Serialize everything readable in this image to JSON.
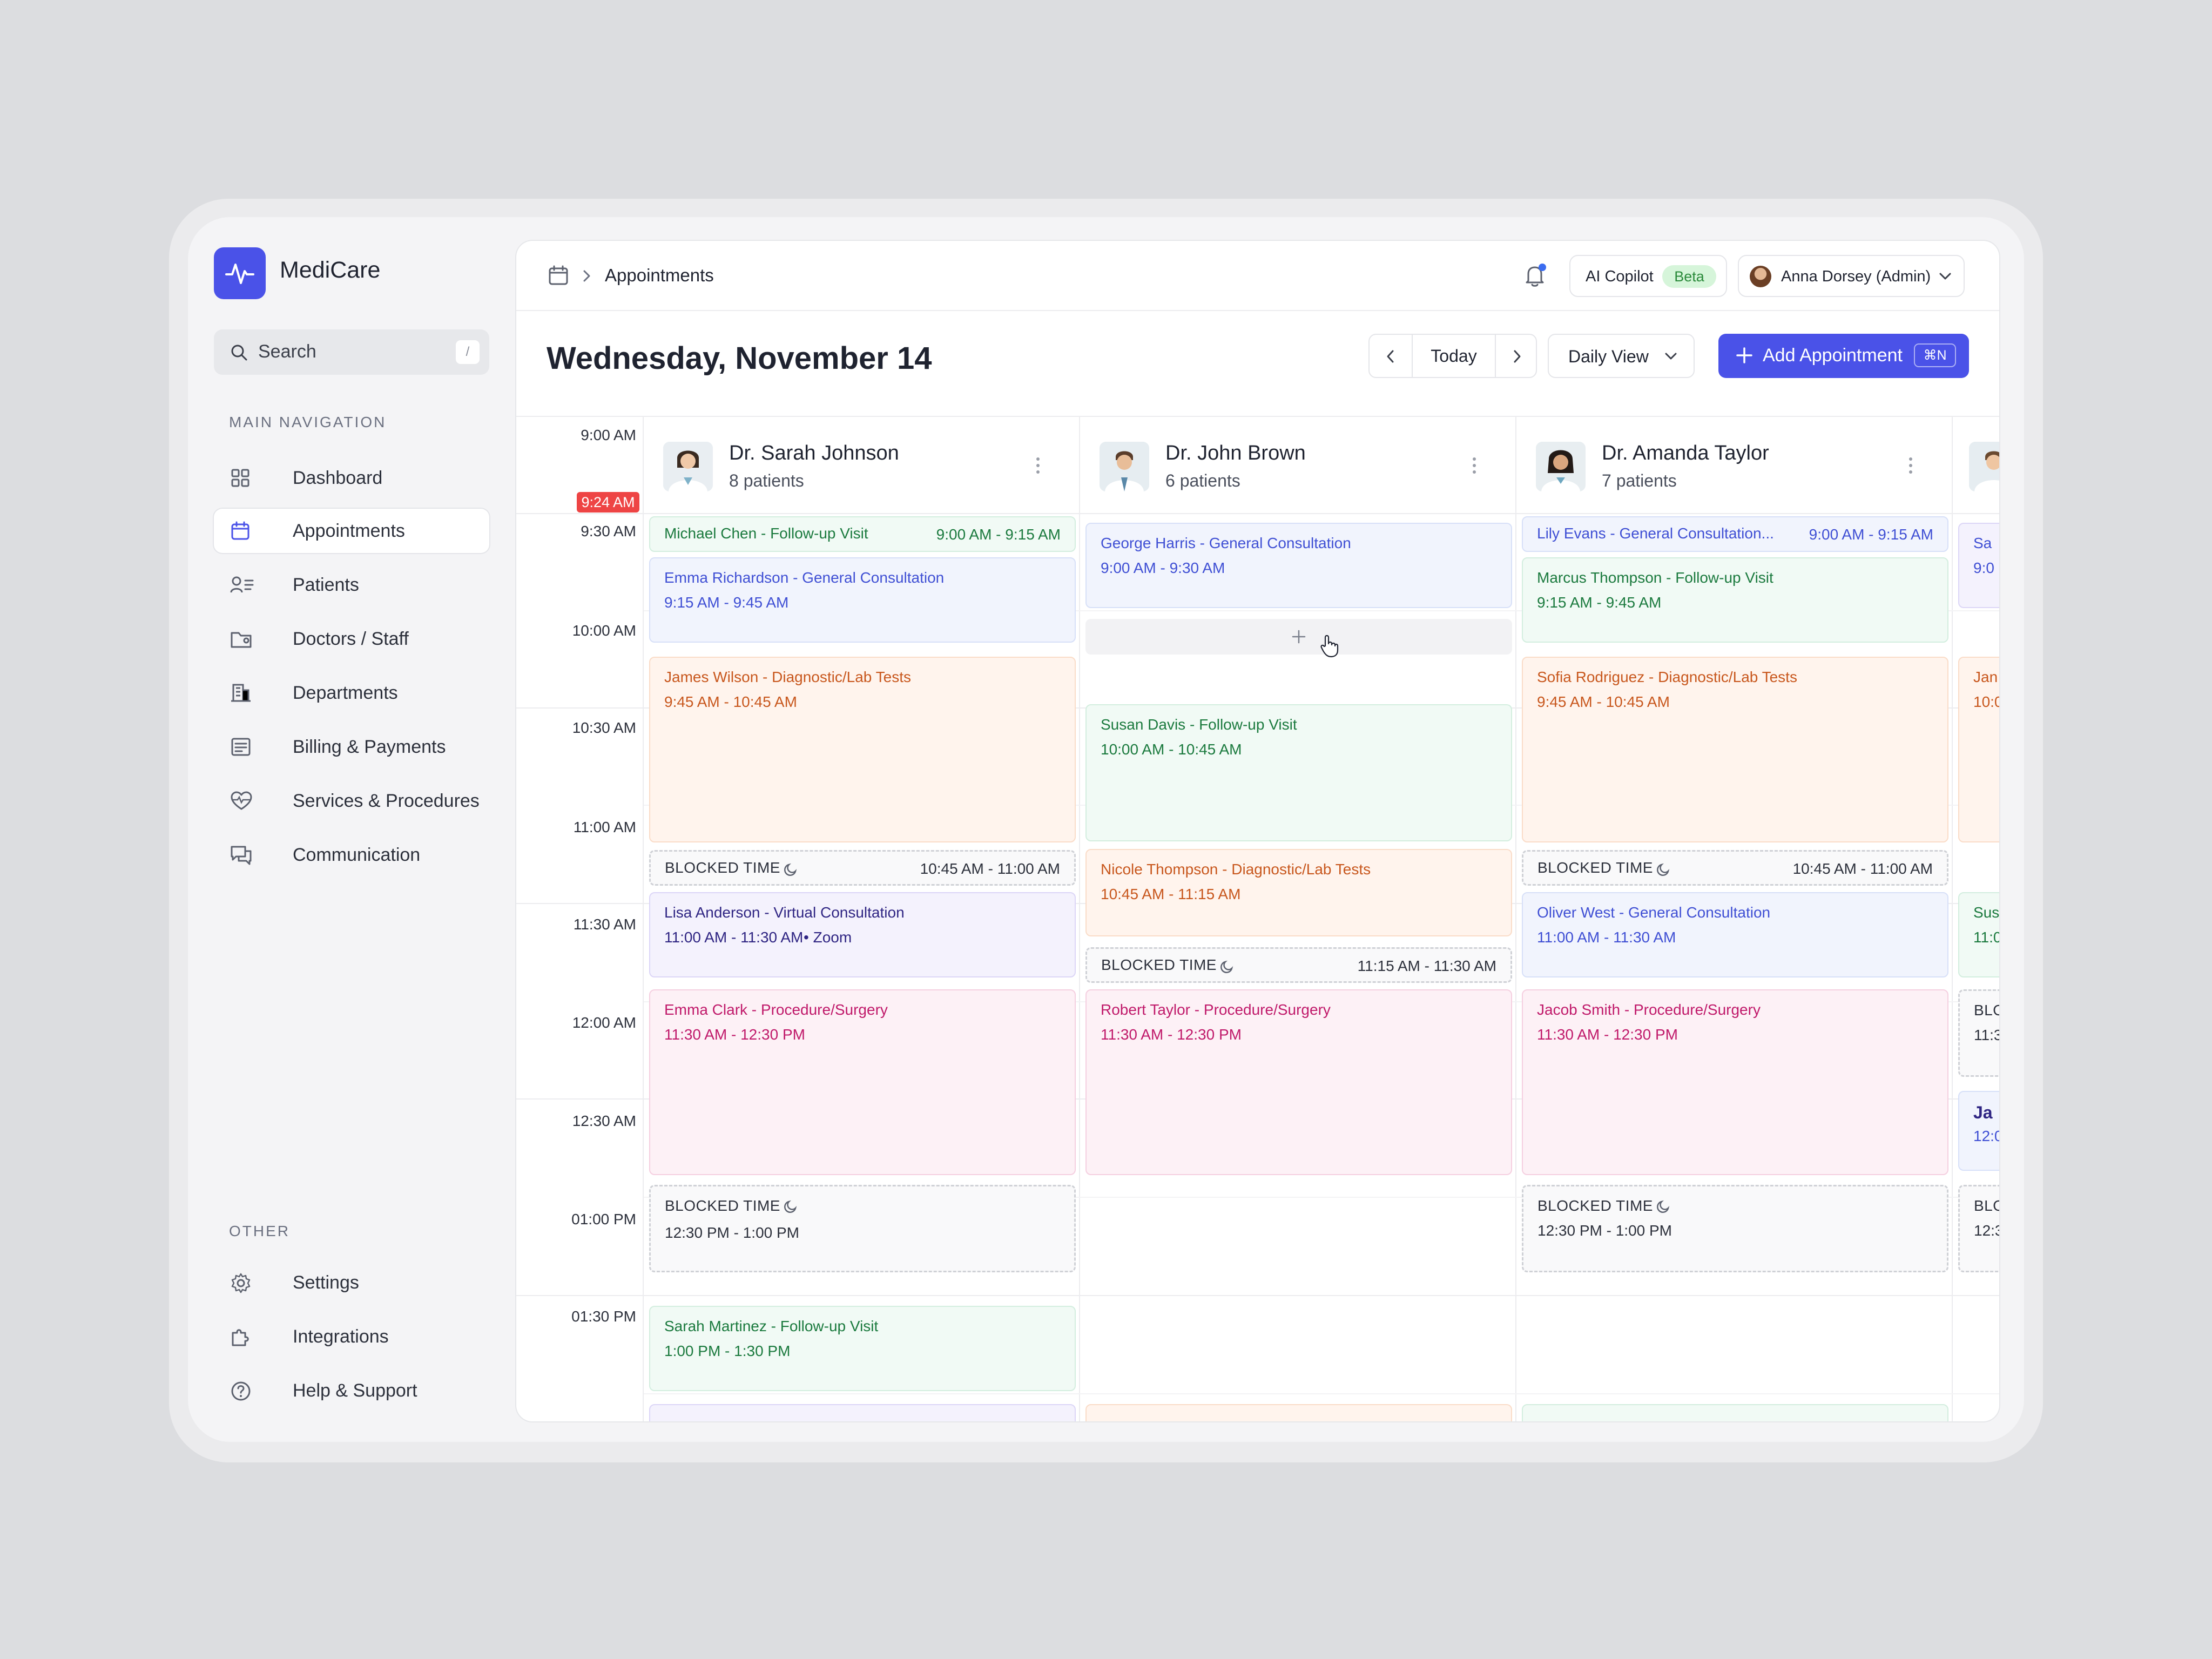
{
  "app": {
    "name": "MediCare"
  },
  "search": {
    "placeholder": "Search",
    "shortcut": "/"
  },
  "nav": {
    "main_heading": "MAIN NAVIGATION",
    "items": [
      {
        "label": "Dashboard",
        "icon": "grid-icon"
      },
      {
        "label": "Appointments",
        "icon": "calendar-icon",
        "active": true
      },
      {
        "label": "Patients",
        "icon": "patients-icon"
      },
      {
        "label": "Doctors / Staff",
        "icon": "staff-icon"
      },
      {
        "label": "Departments",
        "icon": "building-icon"
      },
      {
        "label": "Billing & Payments",
        "icon": "receipt-icon"
      },
      {
        "label": "Services & Procedures",
        "icon": "heart-pulse-icon"
      },
      {
        "label": "Communication",
        "icon": "chat-icon"
      }
    ],
    "other_heading": "OTHER",
    "other_items": [
      {
        "label": "Settings",
        "icon": "gear-icon"
      },
      {
        "label": "Integrations",
        "icon": "puzzle-icon"
      },
      {
        "label": "Help & Support",
        "icon": "help-icon"
      }
    ]
  },
  "topbar": {
    "breadcrumb": "Appointments",
    "copilot_label": "AI Copilot",
    "copilot_badge": "Beta",
    "user_name": "Anna Dorsey (Admin)"
  },
  "toolbar": {
    "date_title": "Wednesday, November 14",
    "today_label": "Today",
    "view_label": "Daily View",
    "add_label": "Add Appointment",
    "add_shortcut": "⌘N"
  },
  "schedule": {
    "current_time": "9:24 AM",
    "time_labels": [
      "9:00 AM",
      "9:30 AM",
      "10:00 AM",
      "10:30 AM",
      "11:00 AM",
      "11:30 AM",
      "12:00 AM",
      "12:30 AM",
      "01:00 PM",
      "01:30 PM"
    ],
    "doctors": [
      {
        "name": "Dr. Sarah Johnson",
        "patients": "8 patients"
      },
      {
        "name": "Dr. John Brown",
        "patients": "6 patients"
      },
      {
        "name": "Dr. Amanda Taylor",
        "patients": "7 patients"
      }
    ],
    "col1": [
      {
        "title": "Michael Chen - Follow-up Visit",
        "time": "9:00 AM - 9:15 AM"
      },
      {
        "title": "Emma Richardson - General Consultation",
        "time": "9:15 AM - 9:45 AM"
      },
      {
        "title": "James Wilson - Diagnostic/Lab Tests",
        "time": "9:45 AM - 10:45 AM"
      },
      {
        "title": "BLOCKED TIME",
        "time": "10:45 AM - 11:00 AM"
      },
      {
        "title": "Lisa Anderson - Virtual Consultation",
        "time": "11:00 AM - 11:30 AM",
        "extra": "Zoom"
      },
      {
        "title": "Emma Clark - Procedure/Surgery",
        "time": "11:30 AM - 12:30 PM"
      },
      {
        "title": "BLOCKED TIME",
        "time": "12:30 PM - 1:00 PM"
      },
      {
        "title": "Sarah Martinez - Follow-up Visit",
        "time": "1:00 PM - 1:30 PM"
      }
    ],
    "col2": [
      {
        "title": "George Harris - General Consultation",
        "time": "9:00 AM - 9:30 AM"
      },
      {
        "title": "Susan Davis - Follow-up Visit",
        "time": "10:00 AM - 10:45 AM"
      },
      {
        "title": "Nicole Thompson - Diagnostic/Lab Tests",
        "time": "10:45 AM - 11:15 AM"
      },
      {
        "title": "BLOCKED TIME",
        "time": "11:15 AM - 11:30 AM"
      },
      {
        "title": "Robert Taylor - Procedure/Surgery",
        "time": "11:30 AM - 12:30 PM"
      }
    ],
    "col3": [
      {
        "title": "Lily Evans - General Consultation...",
        "time": "9:00 AM - 9:15 AM"
      },
      {
        "title": "Marcus Thompson - Follow-up Visit",
        "time": "9:15 AM - 9:45 AM"
      },
      {
        "title": "Sofia Rodriguez - Diagnostic/Lab Tests",
        "time": "9:45 AM - 10:45 AM"
      },
      {
        "title": "BLOCKED TIME",
        "time": "10:45 AM - 11:00 AM"
      },
      {
        "title": "Oliver West - General Consultation",
        "time": "11:00 AM - 11:30 AM"
      },
      {
        "title": "Jacob Smith - Procedure/Surgery",
        "time": "11:30 AM - 12:30 PM"
      },
      {
        "title": "BLOCKED TIME",
        "time": "12:30 PM - 1:00 PM"
      }
    ],
    "col4_partial": [
      "Sa",
      "9:0",
      "Jan",
      "10:0",
      "Sus",
      "11:0",
      "BLO",
      "11:3",
      "Ja",
      "12:0",
      "BLO",
      "12:3"
    ]
  },
  "colors": {
    "accent": "#4a52e8",
    "now_marker": "#ee4444",
    "beta_badge": "#d6f5da"
  }
}
